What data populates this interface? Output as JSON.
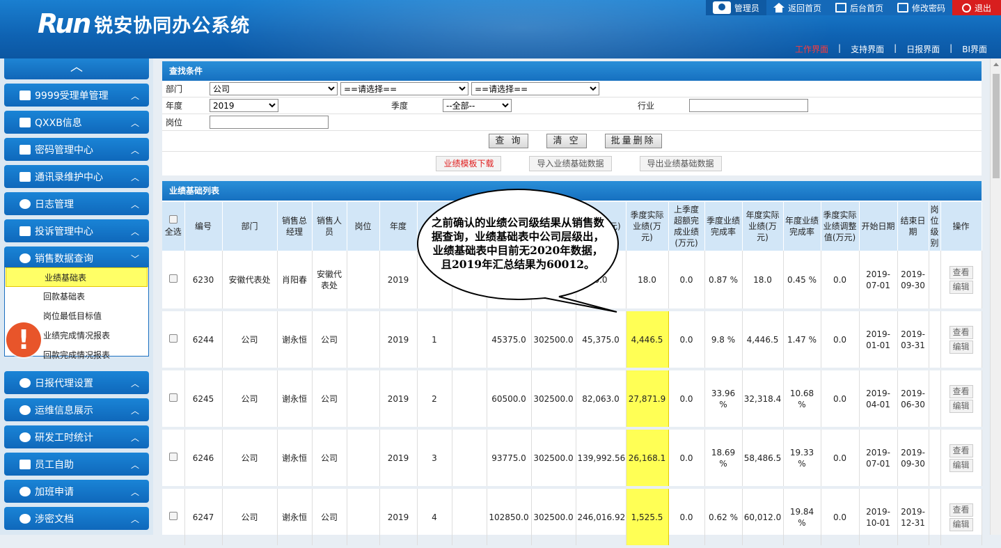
{
  "header": {
    "logo_mark": "Run",
    "app_title": "锐安协同办公系统",
    "top": {
      "admin": "管理员",
      "home": "返回首页",
      "backend": "后台首页",
      "password": "修改密码",
      "exit": "退出"
    },
    "nav": [
      "工作界面",
      "支持界面",
      "日报界面",
      "BI界面"
    ],
    "nav_sep": "|"
  },
  "sidebar": {
    "menus": [
      "9999受理单管理",
      "QXXB信息",
      "密码管理中心",
      "通讯录维护中心",
      "日志管理",
      "投诉管理中心",
      "销售数据查询",
      "日报代理设置",
      "运维信息展示",
      "研发工时统计",
      "员工自助",
      "加班申请",
      "涉密文档"
    ],
    "submenu": [
      "业绩基础表",
      "回款基础表",
      "岗位最低目标值",
      "业绩完成情况报表",
      "回款完成情况报表"
    ]
  },
  "search": {
    "title": "查找条件",
    "dept_label": "部门",
    "dept_value": "公司",
    "dept2": "==请选择==",
    "dept3": "==请选择==",
    "year_label": "年度",
    "year_value": "2019",
    "quarter_label": "季度",
    "quarter_value": "--全部--",
    "industry_label": "行业",
    "post_label": "岗位",
    "query": "查 询",
    "clear": "清 空",
    "batch_delete": "批量删除",
    "download": "业绩模板下载",
    "import": "导入业绩基础数据",
    "export": "导出业绩基础数据"
  },
  "list": {
    "title": "业绩基础列表",
    "headers": [
      "全选",
      "编号",
      "部门",
      "销售总经理",
      "销售人员",
      "岗位",
      "年度",
      "",
      "",
      "",
      "",
      "绩动(万元)",
      "季度实际业绩(万元)",
      "上季度超额完成业绩(万元)",
      "季度业绩完成率",
      "年度实际业绩(万元)",
      "年度业绩完成率",
      "季度实际业绩调整值(万元)",
      "开始日期",
      "结束日期",
      "岗位级别",
      "操作"
    ],
    "rows": [
      [
        "6230",
        "安徽代表处",
        "肖阳春",
        "安徽代表处",
        "",
        "2019",
        "",
        "",
        "",
        "",
        "0.0",
        "18.0",
        "0.0",
        "0.87 %",
        "18.0",
        "0.45 %",
        "0.0",
        "2019-07-01",
        "2019-09-30",
        ""
      ],
      [
        "6244",
        "公司",
        "谢永恒",
        "公司",
        "",
        "2019",
        "1",
        "",
        "45375.0",
        "302500.0",
        "45,375.0",
        "4,446.5",
        "0.0",
        "9.8 %",
        "4,446.5",
        "1.47 %",
        "0.0",
        "2019-01-01",
        "2019-03-31",
        ""
      ],
      [
        "6245",
        "公司",
        "谢永恒",
        "公司",
        "",
        "2019",
        "2",
        "",
        "60500.0",
        "302500.0",
        "82,063.0",
        "27,871.9",
        "0.0",
        "33.96 %",
        "32,318.4",
        "10.68 %",
        "0.0",
        "2019-04-01",
        "2019-06-30",
        ""
      ],
      [
        "6246",
        "公司",
        "谢永恒",
        "公司",
        "",
        "2019",
        "3",
        "",
        "93775.0",
        "302500.0",
        "139,992.56",
        "26,168.1",
        "0.0",
        "18.69 %",
        "58,486.5",
        "19.33 %",
        "0.0",
        "2019-07-01",
        "2019-09-30",
        ""
      ],
      [
        "6247",
        "公司",
        "谢永恒",
        "公司",
        "",
        "2019",
        "4",
        "",
        "102850.0",
        "302500.0",
        "246,016.92",
        "1,525.5",
        "0.0",
        "0.62 %",
        "60,012.0",
        "19.84 %",
        "0.0",
        "2019-10-01",
        "2019-12-31",
        ""
      ]
    ],
    "view": "查看",
    "edit": "编辑"
  },
  "callout": "之前确认的业绩公司级结果从销售数据查询，业绩基础表中公司层级出，业绩基础表中目前无2020年数据，且2019年汇总结果为60012。",
  "alert_symbol": "!"
}
